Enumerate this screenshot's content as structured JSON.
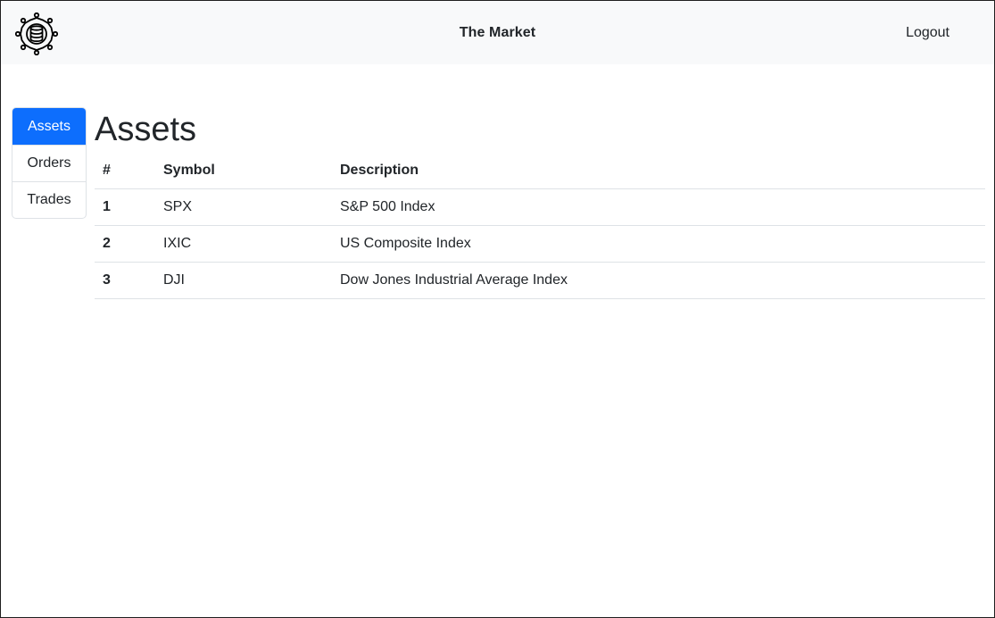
{
  "navbar": {
    "logo_icon": "gear-database-icon",
    "title": "The Market",
    "logout_label": "Logout"
  },
  "sidebar": {
    "items": [
      {
        "label": "Assets",
        "active": true
      },
      {
        "label": "Orders",
        "active": false
      },
      {
        "label": "Trades",
        "active": false
      }
    ]
  },
  "main": {
    "title": "Assets",
    "table": {
      "headers": [
        "#",
        "Symbol",
        "Description"
      ],
      "rows": [
        {
          "num": "1",
          "symbol": "SPX",
          "description": "S&P 500 Index"
        },
        {
          "num": "2",
          "symbol": "IXIC",
          "description": "US Composite Index"
        },
        {
          "num": "3",
          "symbol": "DJI",
          "description": "Dow Jones Industrial Average Index"
        }
      ]
    }
  },
  "colors": {
    "accent": "#0d6efd",
    "navbar_bg": "#f8f9fa",
    "text": "#212529",
    "border": "#dee2e6"
  }
}
